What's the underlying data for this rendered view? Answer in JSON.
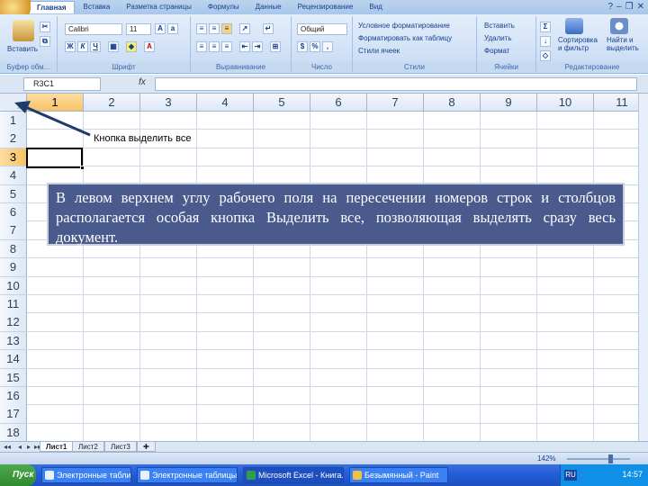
{
  "ribbon": {
    "tabs": [
      "Главная",
      "Вставка",
      "Разметка страницы",
      "Формулы",
      "Данные",
      "Рецензирование",
      "Вид"
    ],
    "active_tab": "Главная",
    "clipboard": {
      "paste": "Вставить",
      "label": "Буфер обм..."
    },
    "font": {
      "name": "Calibri",
      "size": "11",
      "label": "Шрифт"
    },
    "alignment": {
      "label": "Выравнивание"
    },
    "number": {
      "format": "Общий",
      "label": "Число"
    },
    "styles": {
      "cond": "Условное форматирование",
      "table": "Форматировать как таблицу",
      "cell": "Стили ячеек",
      "label": "Стили"
    },
    "cells": {
      "insert": "Вставить",
      "delete": "Удалить",
      "format": "Формат",
      "label": "Ячейки"
    },
    "editing": {
      "sort": "Сортировка и фильтр",
      "find": "Найти и выделить",
      "label": "Редактирование"
    }
  },
  "formula_bar": {
    "namebox": "R3C1",
    "fx": "fx",
    "value": ""
  },
  "grid": {
    "columns": [
      "1",
      "2",
      "3",
      "4",
      "5",
      "6",
      "7",
      "8",
      "9",
      "10",
      "11"
    ],
    "rows": [
      "1",
      "2",
      "3",
      "4",
      "5",
      "6",
      "7",
      "8",
      "9",
      "10",
      "11",
      "12",
      "13",
      "14",
      "15",
      "16",
      "17",
      "18"
    ],
    "selected_column": "1",
    "selected_row": "3"
  },
  "annotation": {
    "callout": "Кнопка выделить все",
    "note": "В левом верхнем углу рабочего поля на пересечении номеров строк и столбцов располагается особая кнопка Выделить все, позволяющая выделять сразу весь документ."
  },
  "sheets": {
    "tabs": [
      "Лист1",
      "Лист2",
      "Лист3"
    ],
    "active": "Лист1"
  },
  "status": {
    "zoom": "142%"
  },
  "taskbar": {
    "start": "Пуск",
    "tasks": [
      "Электронные таблицы ...",
      "Электронные таблицы ...",
      "Microsoft Excel - Книга...",
      "Безымянный - Paint"
    ],
    "active_task": 2,
    "lang": "RU",
    "clock": "14:57"
  },
  "colors": {
    "accent": "#15428b",
    "note_bg": "#4a5a8c",
    "selected_header": "#f7c265"
  }
}
